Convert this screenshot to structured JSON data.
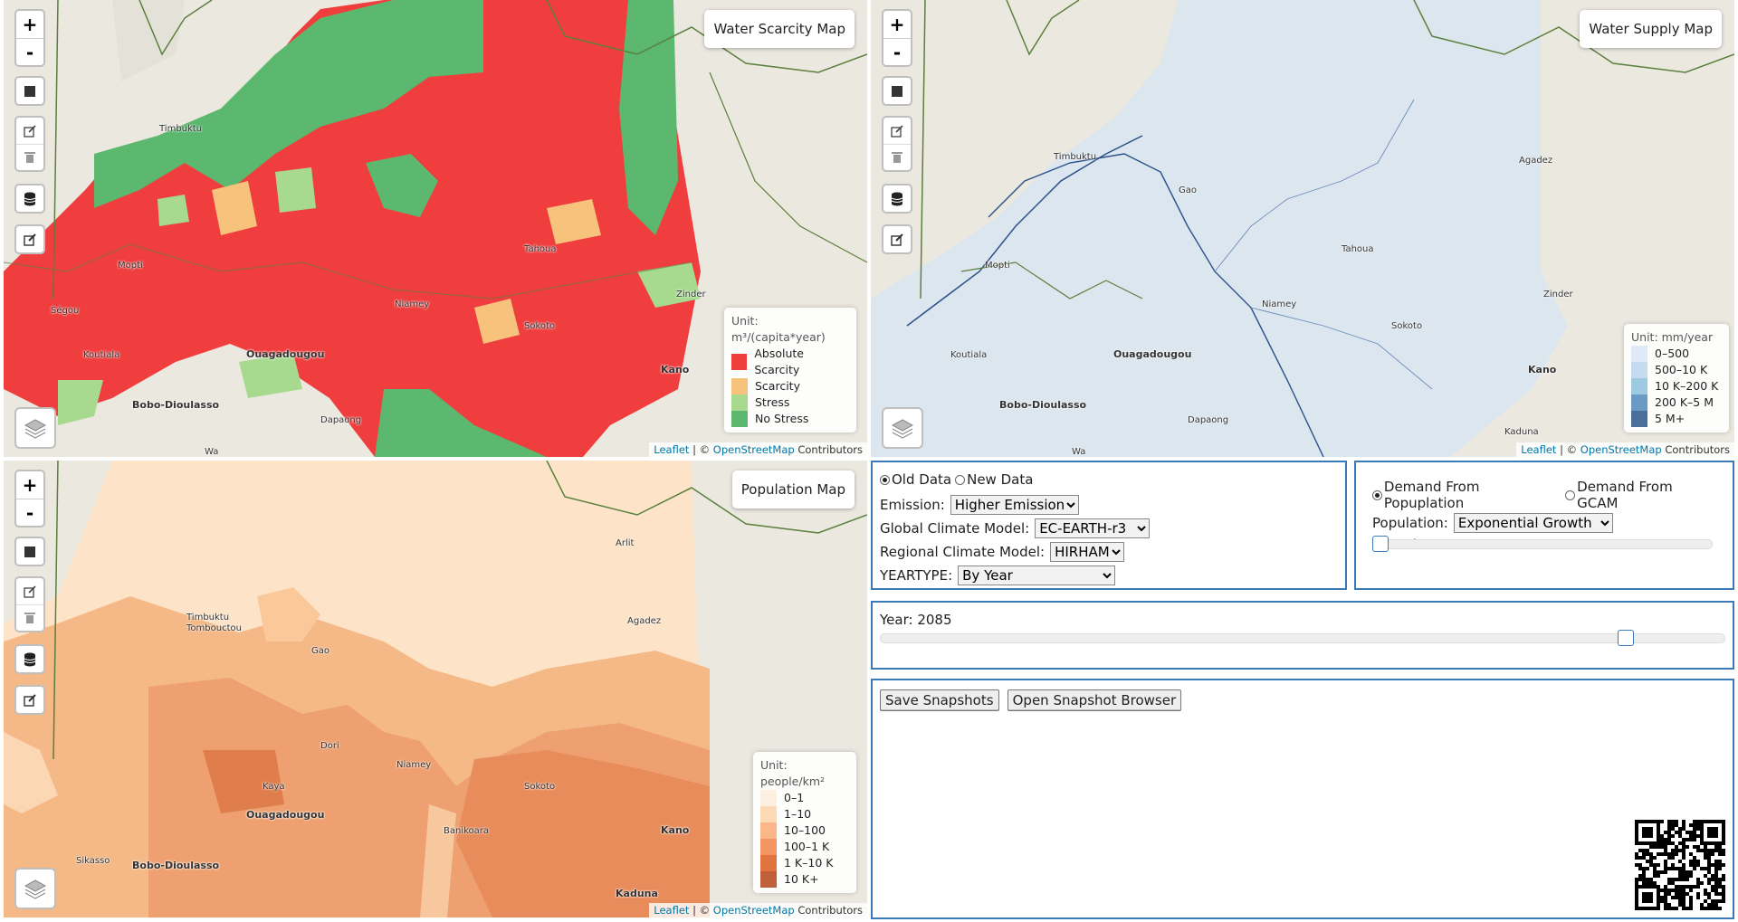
{
  "maps": {
    "scarcity": {
      "title": "Water Scarcity Map",
      "legend_unit": "Unit: m³/(capita*year)",
      "legend": [
        {
          "label": "Absolute Scarcity",
          "color": "#f03e3e"
        },
        {
          "label": "Scarcity",
          "color": "#f7c27b"
        },
        {
          "label": "Stress",
          "color": "#a7da8f"
        },
        {
          "label": "No Stress",
          "color": "#5cb86e"
        }
      ]
    },
    "supply": {
      "title": "Water Supply Map",
      "legend_unit": "Unit: mm/year",
      "legend": [
        {
          "label": "0–500",
          "color": "#deebf7"
        },
        {
          "label": "500–10 K",
          "color": "#c6dbef"
        },
        {
          "label": "10 K–200 K",
          "color": "#9ecae1"
        },
        {
          "label": "200 K–5 M",
          "color": "#6b9ac4"
        },
        {
          "label": "5 M+",
          "color": "#4a6f9a"
        }
      ]
    },
    "population": {
      "title": "Population Map",
      "legend_unit": "Unit: people/km²",
      "legend": [
        {
          "label": "0–1",
          "color": "#fef0e0"
        },
        {
          "label": "1–10",
          "color": "#fdd9b5"
        },
        {
          "label": "10–100",
          "color": "#fbb68a"
        },
        {
          "label": "100–1 K",
          "color": "#f29560"
        },
        {
          "label": "1 K–10 K",
          "color": "#e0743f"
        },
        {
          "label": "10 K+",
          "color": "#c0603a"
        }
      ]
    },
    "zoom_in": "+",
    "zoom_out": "-",
    "attribution_leaflet": "Leaflet",
    "attribution_sep": " | © ",
    "attribution_osm": "OpenStreetMap",
    "attribution_tail": " Contributors",
    "places": {
      "timbuktu": "Timbuktu",
      "tombouctou": "Tombouctou",
      "mopti": "Mopti",
      "gao": "Gao",
      "niamey": "Niamey",
      "tahoua": "Tahoua",
      "zinder": "Zinder",
      "kano": "Kano",
      "sokoto": "Sokoto",
      "ouagadougou": "Ouagadougou",
      "bobo": "Bobo-Dioulasso",
      "koutiala": "Koutiala",
      "segou": "Ségou",
      "sikasso": "Sikasso",
      "agadez": "Agadez",
      "arlit": "Arlit",
      "kaduna": "Kaduna",
      "dapaong": "Dapaong",
      "wa": "Wa",
      "kaya": "Kaya",
      "dori": "Dori",
      "banikoara": "Banikoara"
    }
  },
  "data_panel": {
    "old_data": "Old Data",
    "new_data": "New Data",
    "emission_label": "Emission:",
    "emission_value": "Higher Emission",
    "gcm_label": "Global Climate Model:",
    "gcm_value": "EC-EARTH-r3",
    "rcm_label": "Regional Climate Model:",
    "rcm_value": "HIRHAM",
    "yeartype_label": "YEARTYPE:",
    "yeartype_value": "By Year"
  },
  "demand_panel": {
    "demand_pop": "Demand From Popuplation",
    "demand_gcam": "Demand From GCAM",
    "population_label": "Population:",
    "population_value": "Exponential Growth",
    "growth_rate": "Growth Rate: 1%",
    "growth_rate_fraction": 0.0
  },
  "year_panel": {
    "year_label": "Year: 2085",
    "year_fraction": 0.89
  },
  "snapshot_panel": {
    "save": "Save Snapshots",
    "open": "Open Snapshot Browser"
  }
}
